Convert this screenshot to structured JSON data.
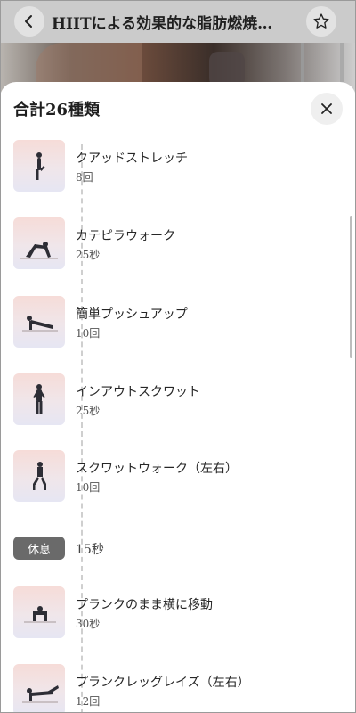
{
  "header": {
    "title": "HIITによる効果的な脂肪燃焼…",
    "back_icon": "chevron-left-icon",
    "favorite_icon": "star-outline-icon"
  },
  "sheet": {
    "title": "合計26種類",
    "close_icon": "close-icon",
    "items": [
      {
        "type": "exercise",
        "name": "クアッドストレッチ",
        "value": "8回"
      },
      {
        "type": "exercise",
        "name": "カテピラウォーク",
        "value": "25秒"
      },
      {
        "type": "exercise",
        "name": "簡単プッシュアップ",
        "value": "10回"
      },
      {
        "type": "exercise",
        "name": "インアウトスクワット",
        "value": "25秒"
      },
      {
        "type": "exercise",
        "name": "スクワットウォーク（左右）",
        "value": "10回"
      },
      {
        "type": "rest",
        "name": "休息",
        "value": "15秒"
      },
      {
        "type": "exercise",
        "name": "プランクのまま横に移動",
        "value": "30秒"
      },
      {
        "type": "exercise",
        "name": "プランクレッグレイズ（左右）",
        "value": "12回"
      }
    ]
  },
  "colors": {
    "header_bg": "#cbcbcb",
    "rest_badge": "#6a6a6a",
    "thumb_top": "#f6dcd8",
    "thumb_bottom": "#e6e6f3"
  }
}
